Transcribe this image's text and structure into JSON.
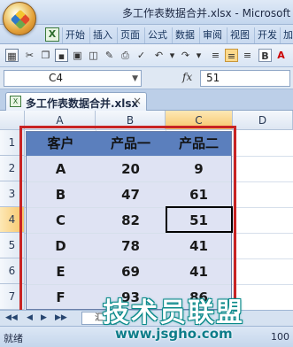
{
  "window": {
    "title": "多工作表数据合并.xlsx - Microsoft E"
  },
  "ribbon": {
    "tabs": [
      "开始",
      "插入",
      "页面",
      "公式",
      "数据",
      "审阅",
      "视图",
      "开发",
      "加"
    ]
  },
  "toolbar": {
    "bold_label": "B",
    "font_color_label": "A"
  },
  "formula_bar": {
    "name_box": "C4",
    "fx_label": "fx",
    "value": "51"
  },
  "document_tab": {
    "label": "多工作表数据合并.xlsx",
    "close": "×"
  },
  "grid": {
    "columns": [
      "A",
      "B",
      "C",
      "D"
    ],
    "rows": [
      "1",
      "2",
      "3",
      "4",
      "5",
      "6",
      "7"
    ],
    "active_column": "C",
    "active_row": "4"
  },
  "table": {
    "headers": [
      "客户",
      "产品一",
      "产品二"
    ],
    "rows": [
      [
        "A",
        "20",
        "9"
      ],
      [
        "B",
        "47",
        "61"
      ],
      [
        "C",
        "82",
        "51"
      ],
      [
        "D",
        "78",
        "41"
      ],
      [
        "E",
        "69",
        "41"
      ],
      [
        "F",
        "93",
        "86"
      ]
    ]
  },
  "sheet_tabs": {
    "partial_label": "汇"
  },
  "status": {
    "text": "就绪",
    "zoom": "100"
  },
  "watermark": {
    "main": "技术员联盟",
    "url": "www.jsgho.com"
  },
  "colors": {
    "header_fill": "#5b7fbd",
    "row_fill": "#dfe3f3",
    "frame": "#c82323",
    "active_header": "#f7c66a"
  }
}
